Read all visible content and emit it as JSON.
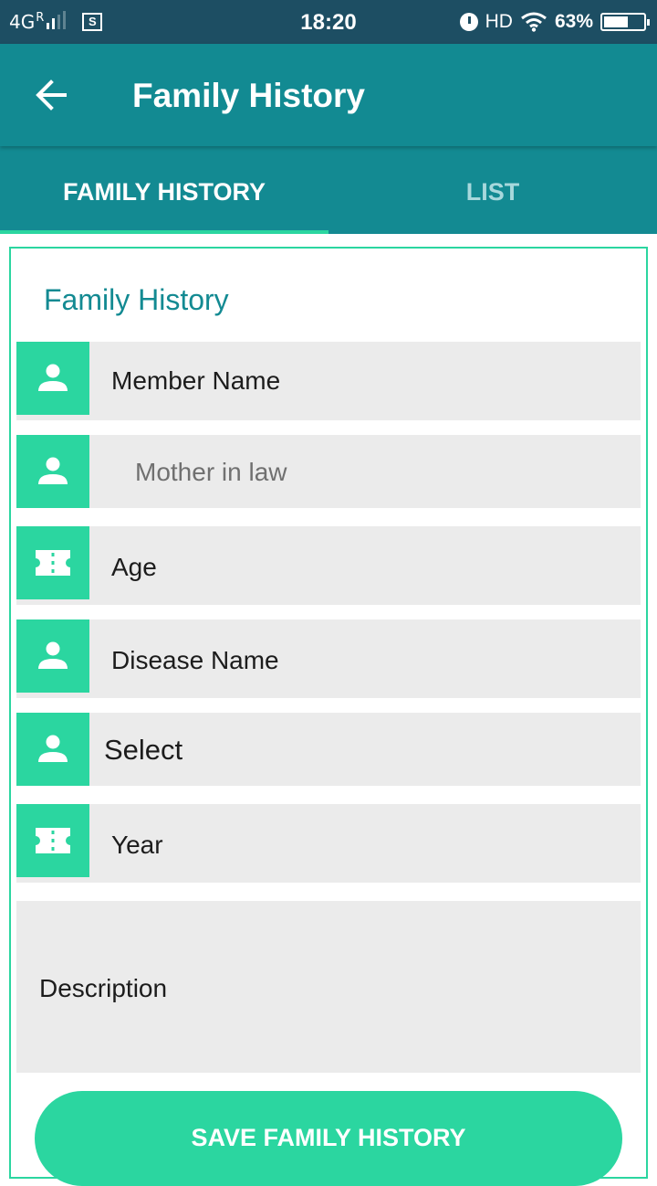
{
  "status_bar": {
    "network": "4G",
    "roaming": "R",
    "time": "18:20",
    "hd": "HD",
    "battery": "63%",
    "battery_level": 0.63,
    "icons": [
      "signal-icon",
      "sim-icon",
      "alarm-icon",
      "wifi-icon",
      "battery-icon"
    ]
  },
  "app_bar": {
    "title": "Family History",
    "back_icon": "arrow-back-icon"
  },
  "tabs": [
    {
      "label": "FAMILY HISTORY",
      "active": true
    },
    {
      "label": "LIST",
      "active": false
    }
  ],
  "form": {
    "title": "Family History",
    "fields": [
      {
        "label": "Member Name",
        "icon": "person-icon"
      },
      {
        "value": "Mother in law",
        "icon": "person-icon"
      },
      {
        "label": "Age",
        "icon": "ticket-icon"
      },
      {
        "label": "Disease Name",
        "icon": "person-icon"
      },
      {
        "value": "Select",
        "icon": "person-icon"
      },
      {
        "label": "Year",
        "icon": "ticket-icon"
      }
    ],
    "description_label": "Description",
    "save_button": "SAVE FAMILY HISTORY"
  },
  "colors": {
    "status_bar": "#1d4e63",
    "primary": "#128a92",
    "accent": "#2bd6a0",
    "field_bg": "#ebebeb"
  }
}
